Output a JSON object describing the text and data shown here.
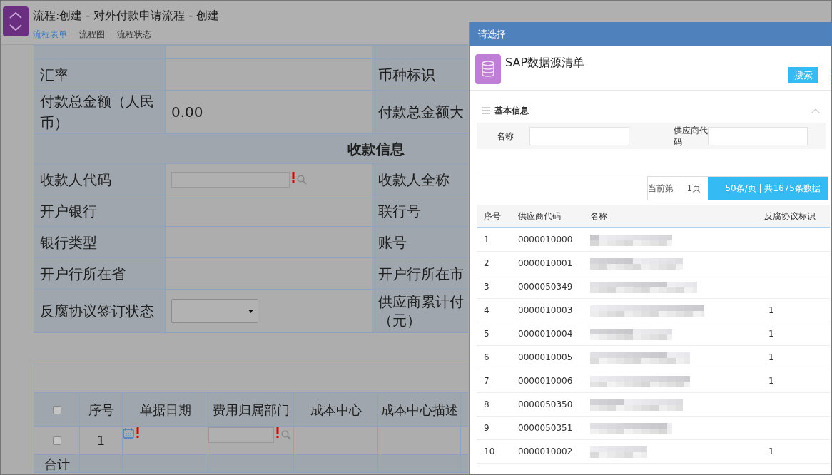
{
  "header": {
    "title": "流程:创建 - 对外付款申请流程 - 创建",
    "tabs": [
      {
        "label": "流程表单",
        "selected": true
      },
      {
        "label": "流程图",
        "selected": false
      },
      {
        "label": "流程状态",
        "selected": false
      }
    ]
  },
  "form": {
    "rows": [
      {
        "kind": "pair",
        "label": "汇率",
        "value": {
          "kind": "empty"
        },
        "label_2": "币种标识"
      },
      {
        "kind": "pair",
        "label": "付款总金额（人民币）",
        "value": {
          "kind": "text",
          "text": "0.00"
        },
        "label_2": "付款总金额大"
      },
      {
        "kind": "section",
        "title": "收款信息"
      },
      {
        "kind": "pair",
        "label": "收款人代码",
        "value": {
          "kind": "lookup",
          "required": true
        },
        "label_2": "收款人全称"
      },
      {
        "kind": "pair",
        "label": "开户银行",
        "value": {
          "kind": "empty"
        },
        "label_2": "联行号"
      },
      {
        "kind": "pair",
        "label": "银行类型",
        "value": {
          "kind": "empty"
        },
        "label_2": "账号"
      },
      {
        "kind": "pair",
        "label": "开户行所在省",
        "value": {
          "kind": "empty"
        },
        "label_2": "开户行所在市"
      },
      {
        "kind": "pair",
        "label": "反腐协议签订状态",
        "value": {
          "kind": "select"
        },
        "label_2": "供应商累计付",
        "label_2_cont": "（元）"
      }
    ]
  },
  "details": {
    "select_all_checked": false,
    "columns": [
      "序号",
      "单据日期",
      "费用归属部门",
      "成本中心",
      "成本中心描述"
    ],
    "rows": [
      {
        "checked": false,
        "index": "1",
        "cells": [
          {
            "kind": "date",
            "required": true
          },
          {
            "kind": "lookup",
            "required": true
          },
          {
            "kind": "empty"
          },
          {
            "kind": "empty"
          }
        ]
      }
    ],
    "footer": "合计"
  },
  "dialog": {
    "title": "请选择",
    "list_title": "SAP数据源清单",
    "search_button": "搜索",
    "section": {
      "title": "基本信息",
      "expanded": true
    },
    "filters": [
      {
        "label": "名称"
      },
      {
        "label": "供应商代码"
      }
    ],
    "pager": {
      "prefix": "当前第",
      "page": "1页",
      "summary": "50条/页 | 共1675条数据"
    },
    "columns": [
      "序号",
      "供应商代码",
      "名称",
      "反腐协议标识"
    ],
    "rows": [
      {
        "index": "1",
        "code": "0000010000"
      },
      {
        "index": "2",
        "code": "0000010001"
      },
      {
        "index": "3",
        "code": "0000050349"
      },
      {
        "index": "4",
        "code": "0000010003",
        "flag": "1"
      },
      {
        "index": "5",
        "code": "0000010004",
        "flag": "1"
      },
      {
        "index": "6",
        "code": "0000010005",
        "flag": "1"
      },
      {
        "index": "7",
        "code": "0000010006",
        "flag": "1"
      },
      {
        "index": "8",
        "code": "0000050350"
      },
      {
        "index": "9",
        "code": "0000050351"
      },
      {
        "index": "10",
        "code": "0000010002",
        "flag": "1"
      }
    ]
  }
}
